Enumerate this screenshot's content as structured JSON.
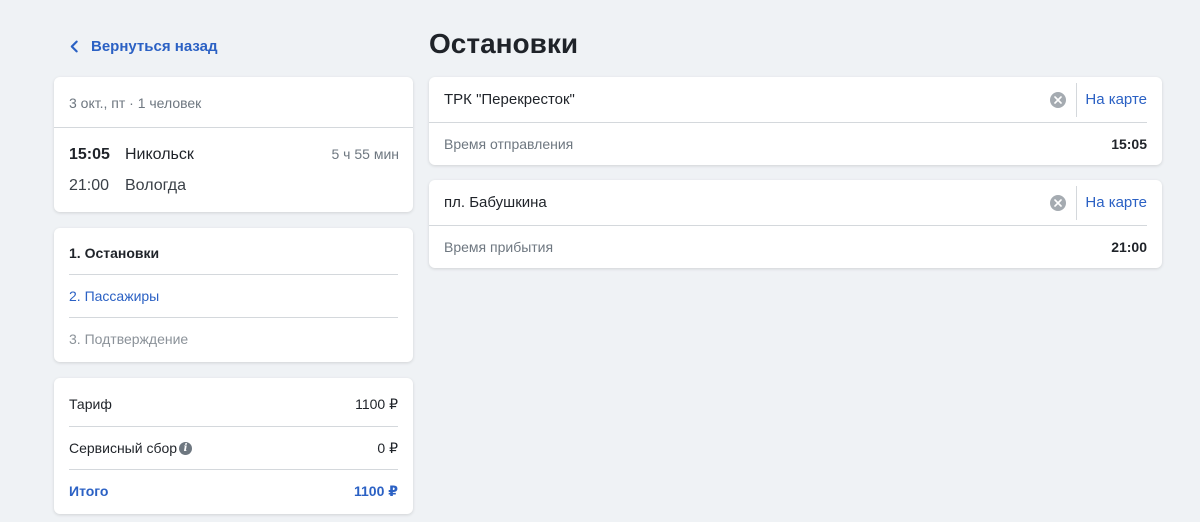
{
  "back": {
    "label": "Вернуться назад"
  },
  "trip": {
    "summary": "3 окт., пт · 1 человек",
    "departure": {
      "time": "15:05",
      "city": "Никольск"
    },
    "arrival": {
      "time": "21:00",
      "city": "Вологда"
    },
    "duration": "5 ч 55 мин"
  },
  "steps": [
    {
      "label": "1. Остановки"
    },
    {
      "label": "2. Пассажиры"
    },
    {
      "label": "3. Подтверждение"
    }
  ],
  "prices": {
    "tariff": {
      "label": "Тариф",
      "value": "1100 ₽"
    },
    "fee": {
      "label": "Сервисный сбор",
      "value": "0 ₽",
      "icon": "info-icon"
    },
    "total": {
      "label": "Итого",
      "value": "1100 ₽"
    }
  },
  "main": {
    "title": "Остановки",
    "stops": [
      {
        "name": "ТРК \"Перекресток\"",
        "map_label": "На карте",
        "time_label": "Время отправления",
        "time": "15:05"
      },
      {
        "name": "пл. Бабушкина",
        "map_label": "На карте",
        "time_label": "Время прибытия",
        "time": "21:00"
      }
    ]
  },
  "colors": {
    "accent": "#2b61c4",
    "background": "#eff2f5",
    "muted": "#6e7780"
  }
}
